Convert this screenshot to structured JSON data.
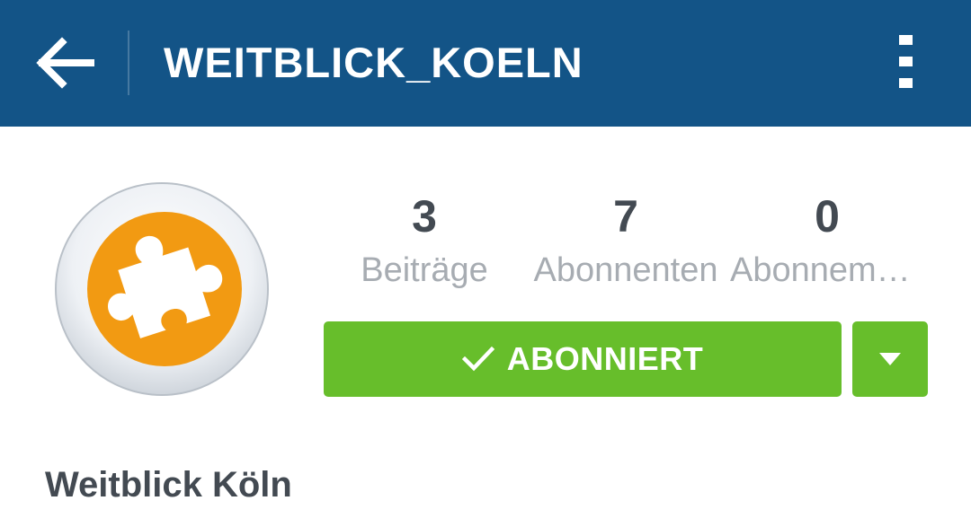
{
  "colors": {
    "appbar": "#135487",
    "accent_green": "#67be2b",
    "avatar_orange": "#f29a12",
    "text_dark": "#434a52",
    "text_muted": "#a7acb2"
  },
  "appbar": {
    "back_icon": "arrow-left-icon",
    "title": "WEITBLICK_KOELN",
    "menu_icon": "more-vertical-icon"
  },
  "profile": {
    "avatar_icon": "puzzle-piece-icon",
    "stats": [
      {
        "value": "3",
        "label": "Beiträge"
      },
      {
        "value": "7",
        "label": "Abonnenten"
      },
      {
        "value": "0",
        "label": "Abonnements"
      }
    ],
    "follow_button": {
      "label": "ABONNIERT",
      "icon": "check-icon"
    },
    "dropdown_icon": "caret-down-icon",
    "name": "Weitblick Köln"
  }
}
